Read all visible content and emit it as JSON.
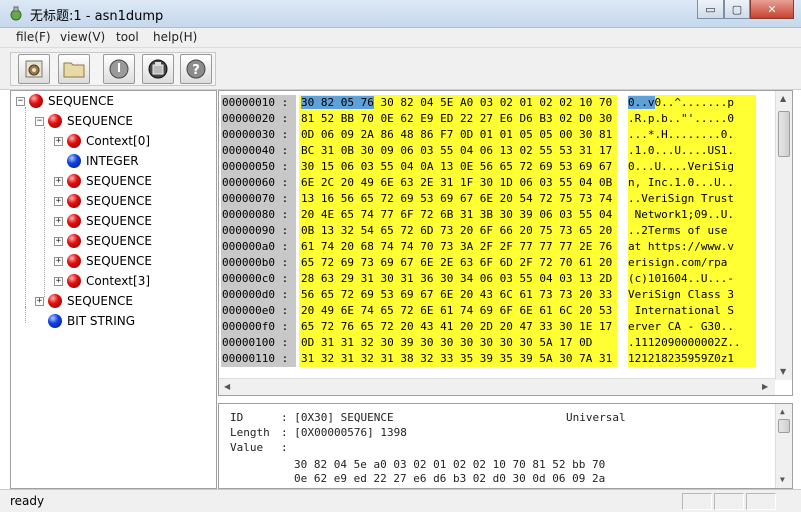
{
  "window": {
    "title": "无标题:1 - asn1dump",
    "min_glyph": "▭",
    "max_glyph": "▢",
    "close_glyph": "✕"
  },
  "menu": [
    "file(F)",
    "view(V)",
    "tool",
    "help(H)"
  ],
  "toolbar": {
    "buttons": [
      "gear-icon",
      "folder-icon",
      "power-icon",
      "export-icon",
      "help-icon"
    ]
  },
  "tree": [
    {
      "label": "SEQUENCE",
      "color": "red",
      "expander": "−"
    },
    {
      "label": "SEQUENCE",
      "color": "red",
      "expander": "−"
    },
    {
      "label": "Context[0]",
      "color": "red",
      "expander": "+"
    },
    {
      "label": "INTEGER",
      "color": "blue",
      "expander": ""
    },
    {
      "label": "SEQUENCE",
      "color": "red",
      "expander": "+"
    },
    {
      "label": "SEQUENCE",
      "color": "red",
      "expander": "+"
    },
    {
      "label": "SEQUENCE",
      "color": "red",
      "expander": "+"
    },
    {
      "label": "SEQUENCE",
      "color": "red",
      "expander": "+"
    },
    {
      "label": "SEQUENCE",
      "color": "red",
      "expander": "+"
    },
    {
      "label": "Context[3]",
      "color": "red",
      "expander": "+"
    },
    {
      "label": "SEQUENCE",
      "color": "red",
      "expander": "+"
    },
    {
      "label": "BIT STRING",
      "color": "blue",
      "expander": ""
    }
  ],
  "hex": {
    "rows": [
      {
        "addr": "00000010 :",
        "pre": "",
        "hl": "30 82 05 76",
        "bytes": " 30 82 04 5E A0 03 02 01 02 02 10 70",
        "ascii_hl": "0..v",
        "ascii": "0..^.......p"
      },
      {
        "addr": "00000020 :",
        "pre": "",
        "hl": "",
        "bytes": "81 52 BB 70 0E 62 E9 ED 22 27 E6 D6 B3 02 D0 30",
        "ascii_hl": "",
        "ascii": ".R.p.b..\"'.....0"
      },
      {
        "addr": "00000030 :",
        "pre": "",
        "hl": "",
        "bytes": "0D 06 09 2A 86 48 86 F7 0D 01 01 05 05 00 30 81",
        "ascii_hl": "",
        "ascii": "...*.H........0."
      },
      {
        "addr": "00000040 :",
        "pre": "",
        "hl": "",
        "bytes": "BC 31 0B 30 09 06 03 55 04 06 13 02 55 53 31 17",
        "ascii_hl": "",
        "ascii": ".1.0...U....US1."
      },
      {
        "addr": "00000050 :",
        "pre": "",
        "hl": "",
        "bytes": "30 15 06 03 55 04 0A 13 0E 56 65 72 69 53 69 67",
        "ascii_hl": "",
        "ascii": "0...U....VeriSig"
      },
      {
        "addr": "00000060 :",
        "pre": "",
        "hl": "",
        "bytes": "6E 2C 20 49 6E 63 2E 31 1F 30 1D 06 03 55 04 0B",
        "ascii_hl": "",
        "ascii": "n, Inc.1.0...U.."
      },
      {
        "addr": "00000070 :",
        "pre": "",
        "hl": "",
        "bytes": "13 16 56 65 72 69 53 69 67 6E 20 54 72 75 73 74",
        "ascii_hl": "",
        "ascii": "..VeriSign Trust"
      },
      {
        "addr": "00000080 :",
        "pre": "",
        "hl": "",
        "bytes": "20 4E 65 74 77 6F 72 6B 31 3B 30 39 06 03 55 04",
        "ascii_hl": "",
        "ascii": " Network1;09..U."
      },
      {
        "addr": "00000090 :",
        "pre": "",
        "hl": "",
        "bytes": "0B 13 32 54 65 72 6D 73 20 6F 66 20 75 73 65 20",
        "ascii_hl": "",
        "ascii": "..2Terms of use "
      },
      {
        "addr": "000000a0 :",
        "pre": "",
        "hl": "",
        "bytes": "61 74 20 68 74 74 70 73 3A 2F 2F 77 77 77 2E 76",
        "ascii_hl": "",
        "ascii": "at https://www.v"
      },
      {
        "addr": "000000b0 :",
        "pre": "",
        "hl": "",
        "bytes": "65 72 69 73 69 67 6E 2E 63 6F 6D 2F 72 70 61 20",
        "ascii_hl": "",
        "ascii": "erisign.com/rpa "
      },
      {
        "addr": "000000c0 :",
        "pre": "",
        "hl": "",
        "bytes": "28 63 29 31 30 31 36 30 34 06 03 55 04 03 13 2D",
        "ascii_hl": "",
        "ascii": "(c)101604..U...-"
      },
      {
        "addr": "000000d0 :",
        "pre": "",
        "hl": "",
        "bytes": "56 65 72 69 53 69 67 6E 20 43 6C 61 73 73 20 33",
        "ascii_hl": "",
        "ascii": "VeriSign Class 3"
      },
      {
        "addr": "000000e0 :",
        "pre": "",
        "hl": "",
        "bytes": "20 49 6E 74 65 72 6E 61 74 69 6F 6E 61 6C 20 53",
        "ascii_hl": "",
        "ascii": " International S"
      },
      {
        "addr": "000000f0 :",
        "pre": "",
        "hl": "",
        "bytes": "65 72 76 65 72 20 43 41 20 2D 20 47 33 30 1E 17",
        "ascii_hl": "",
        "ascii": "erver CA - G30.."
      },
      {
        "addr": "00000100 :",
        "pre": "",
        "hl": "",
        "bytes": "0D 31 31 32 30 39 30 30 30 30 30 30 5A 17 0D",
        "ascii_hl": "",
        "ascii": ".1112090000002Z.."
      },
      {
        "addr": "00000110 :",
        "pre": "",
        "hl": "",
        "bytes": "31 32 31 32 31 38 32 33 35 39 35 39 5A 30 7A 31",
        "ascii_hl": "",
        "ascii": "121218235959Z0z1"
      }
    ]
  },
  "info": {
    "id_label": "ID",
    "id_value": ": [0X30] SEQUENCE",
    "id_class": "Universal",
    "length_label": "Length",
    "length_value": ": [0X00000576] 1398",
    "value_label": "Value",
    "value_sep": ":",
    "value_line1": "30 82 04 5e a0 03 02 01 02 02 10 70 81 52 bb 70",
    "value_line2": "0e 62 e9 ed 22 27 e6 d6 b3 02 d0 30 0d 06 09 2a"
  },
  "status": {
    "text": "ready"
  }
}
